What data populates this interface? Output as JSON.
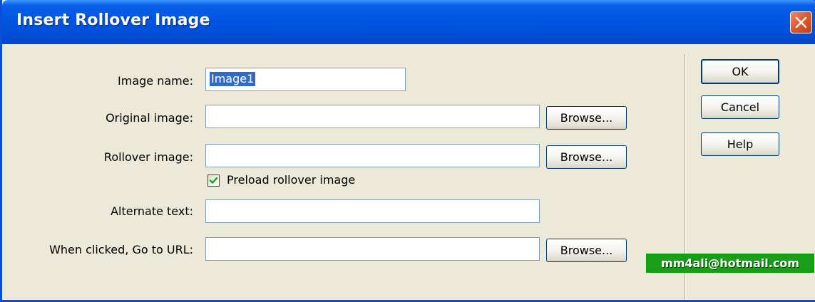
{
  "window": {
    "title": "Insert Rollover Image"
  },
  "form": {
    "image_name": {
      "label": "Image name:",
      "value": "Image1"
    },
    "original_image": {
      "label": "Original image:",
      "value": "",
      "browse_label": "Browse..."
    },
    "rollover_image": {
      "label": "Rollover image:",
      "value": "",
      "browse_label": "Browse..."
    },
    "preload": {
      "label": "Preload rollover image",
      "checked": true
    },
    "alternate_text": {
      "label": "Alternate text:",
      "value": ""
    },
    "url": {
      "label": "When clicked, Go to URL:",
      "value": "",
      "browse_label": "Browse..."
    }
  },
  "actions": {
    "ok_label": "OK",
    "cancel_label": "Cancel",
    "help_label": "Help"
  },
  "watermark": {
    "text": "mm4ali@hotmail.com"
  },
  "colors": {
    "titlebar": "#0054e3",
    "face": "#ece9d8",
    "selection": "#316ac5",
    "checkmark": "#21a121",
    "watermark_bg": "#1a9e1a"
  }
}
